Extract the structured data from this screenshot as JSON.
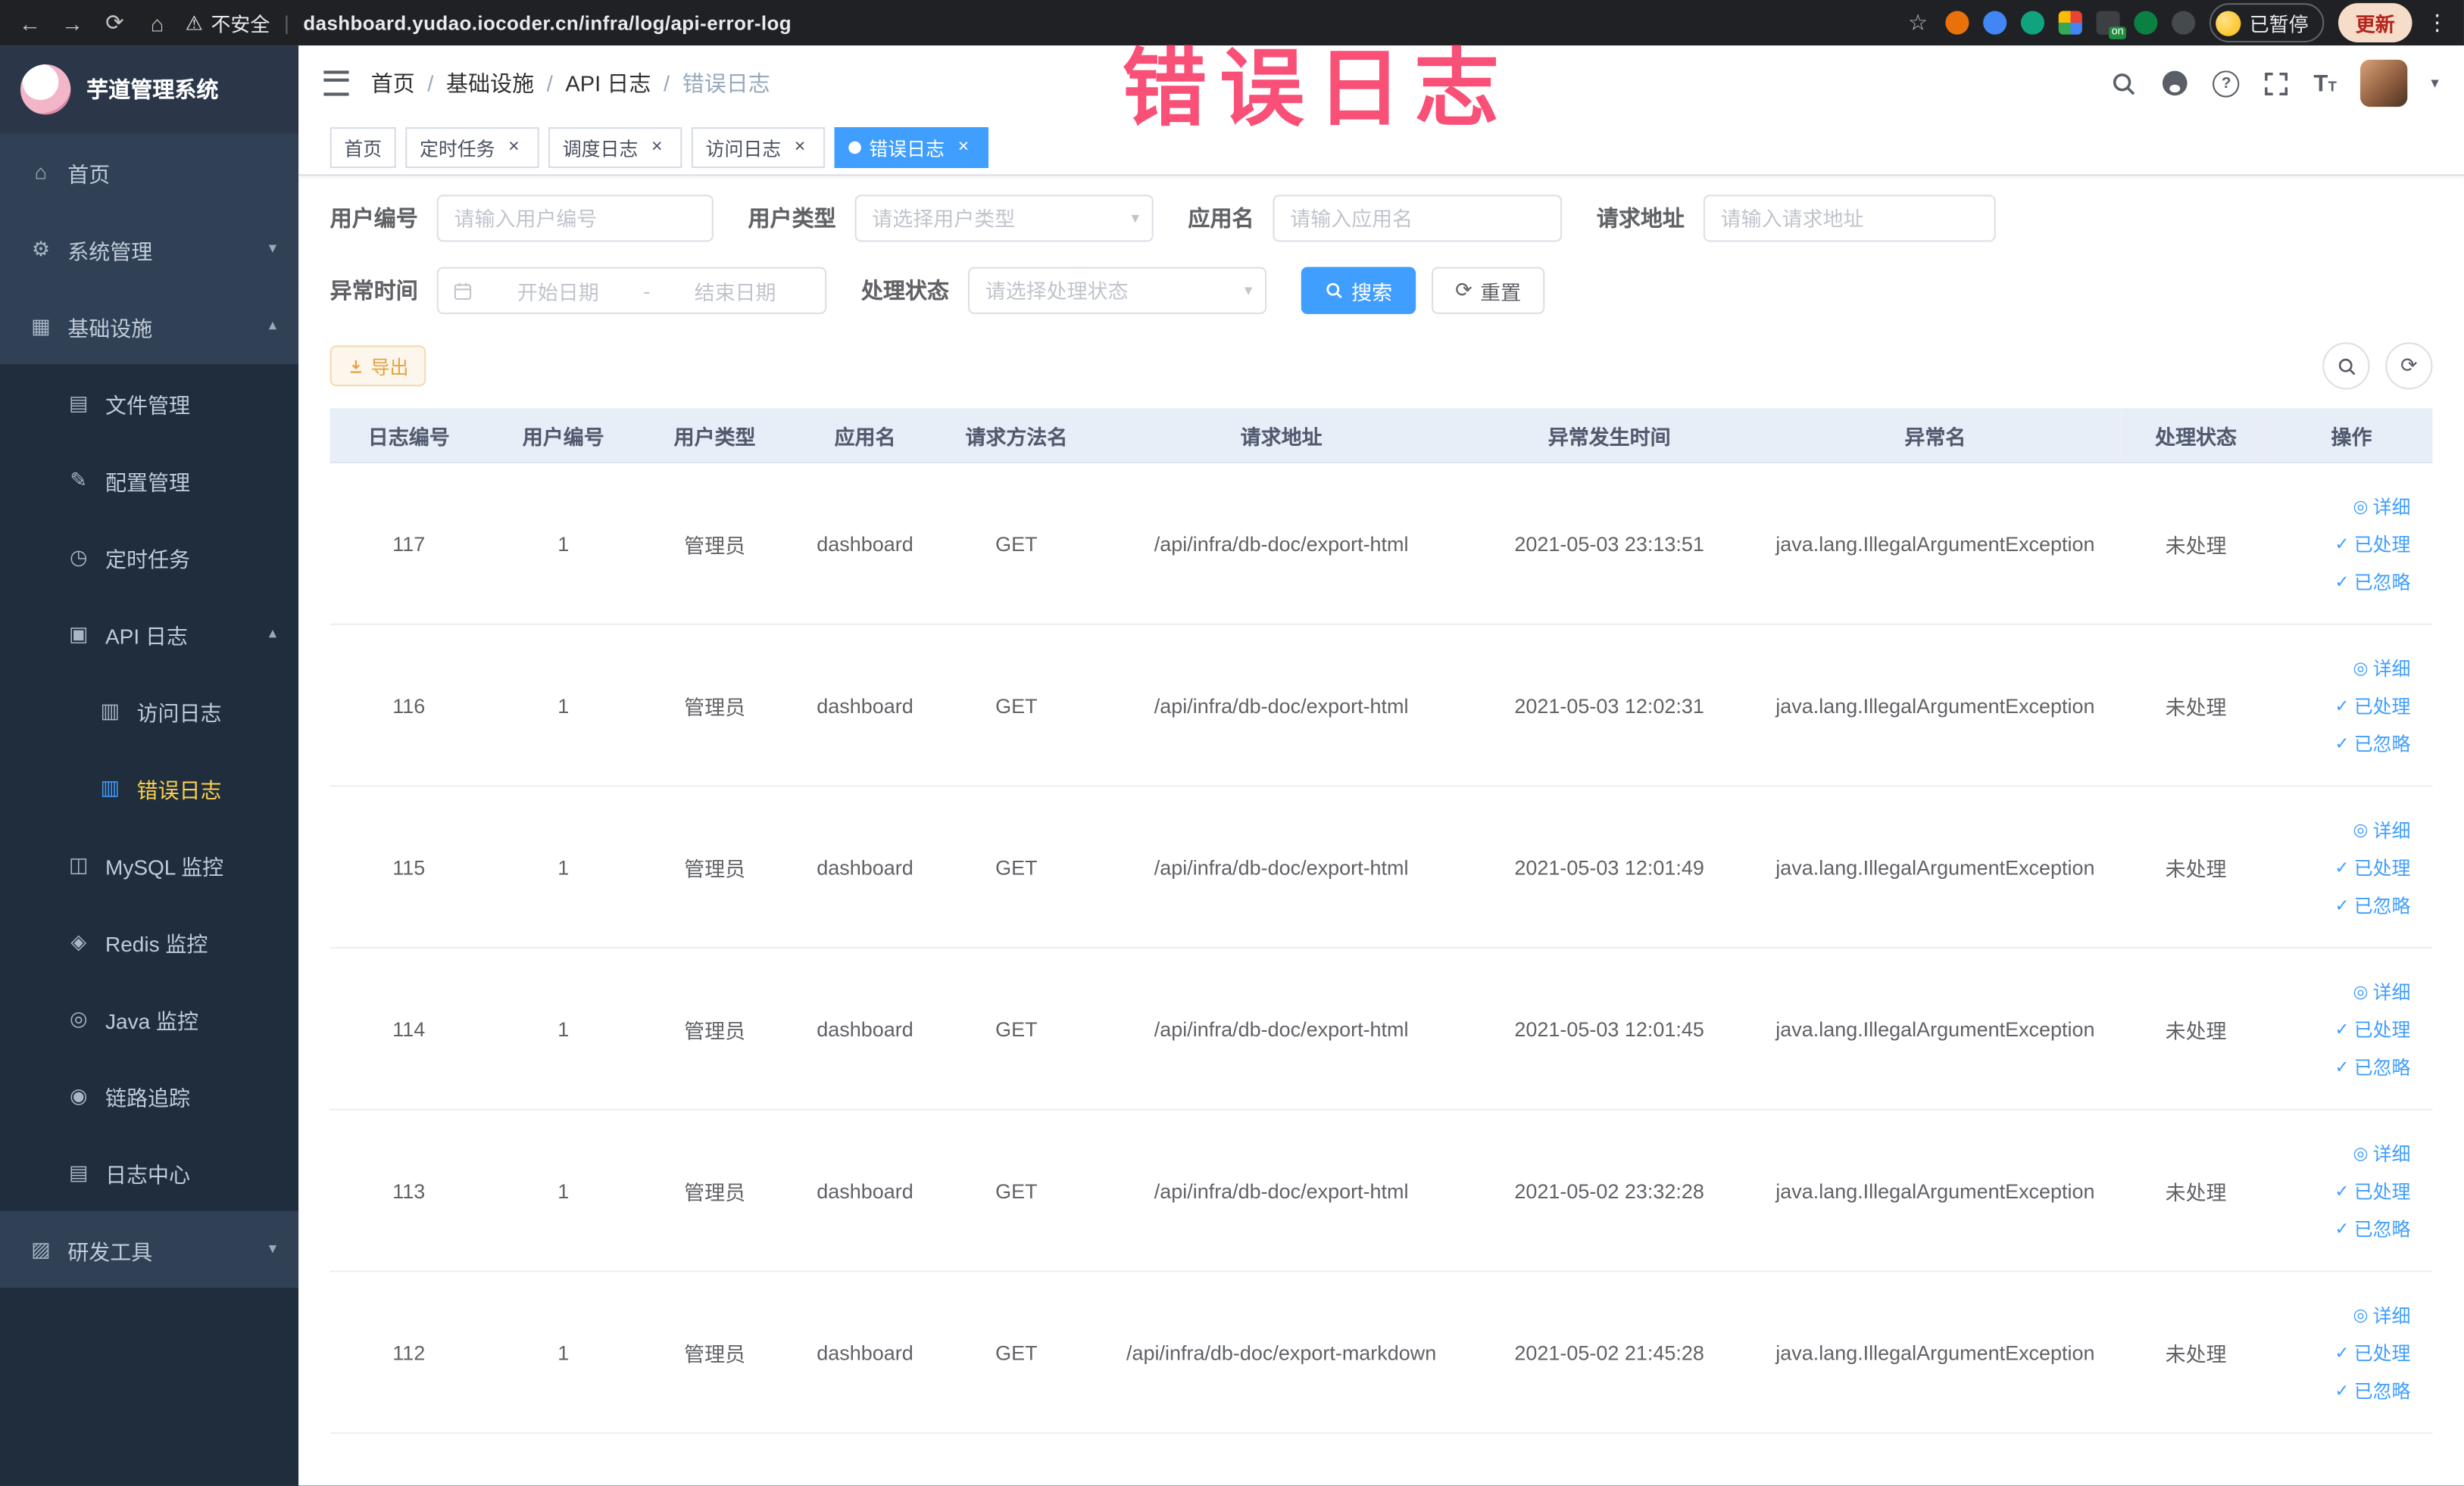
{
  "browser": {
    "security_label": "不安全",
    "url": "dashboard.yudao.iocoder.cn/infra/log/api-error-log",
    "extension_badge": "on",
    "profile_chip_label": "已暂停",
    "update_chip_label": "更新"
  },
  "watermark": "错误日志",
  "sidebar": {
    "title": "芋道管理系统",
    "items": [
      {
        "label": "首页",
        "icon": "⌂"
      },
      {
        "label": "系统管理",
        "icon": "⚙",
        "arrow": "▾"
      },
      {
        "label": "基础设施",
        "icon": "▦",
        "arrow": "▴"
      },
      {
        "label": "文件管理",
        "icon": "▤"
      },
      {
        "label": "配置管理",
        "icon": "✎"
      },
      {
        "label": "定时任务",
        "icon": "◷"
      },
      {
        "label": "API 日志",
        "icon": "▣",
        "arrow": "▴"
      },
      {
        "label": "访问日志",
        "icon": "▥"
      },
      {
        "label": "错误日志",
        "icon": "▥"
      },
      {
        "label": "MySQL 监控",
        "icon": "◫"
      },
      {
        "label": "Redis 监控",
        "icon": "◈"
      },
      {
        "label": "Java 监控",
        "icon": "◎"
      },
      {
        "label": "链路追踪",
        "icon": "◉"
      },
      {
        "label": "日志中心",
        "icon": "▤"
      },
      {
        "label": "研发工具",
        "icon": "▨",
        "arrow": "▾"
      }
    ]
  },
  "breadcrumb": {
    "items": [
      "首页",
      "基础设施",
      "API 日志",
      "错误日志"
    ],
    "separator": "/"
  },
  "tags": [
    {
      "label": "首页"
    },
    {
      "label": "定时任务"
    },
    {
      "label": "调度日志"
    },
    {
      "label": "访问日志"
    },
    {
      "label": "错误日志"
    }
  ],
  "filters": {
    "user_id": {
      "label": "用户编号",
      "placeholder": "请输入用户编号"
    },
    "user_type": {
      "label": "用户类型",
      "placeholder": "请选择用户类型"
    },
    "app_name": {
      "label": "应用名",
      "placeholder": "请输入应用名"
    },
    "request_url": {
      "label": "请求地址",
      "placeholder": "请输入请求地址"
    },
    "exception_time": {
      "label": "异常时间",
      "start_placeholder": "开始日期",
      "range_separator": "-",
      "end_placeholder": "结束日期"
    },
    "process_status": {
      "label": "处理状态",
      "placeholder": "请选择处理状态"
    },
    "search_label": "搜索",
    "reset_label": "重置"
  },
  "toolbar": {
    "export_label": "导出"
  },
  "table": {
    "columns": [
      "日志编号",
      "用户编号",
      "用户类型",
      "应用名",
      "请求方法名",
      "请求地址",
      "异常发生时间",
      "异常名",
      "处理状态",
      "操作"
    ],
    "column_keys": [
      "id",
      "user_id",
      "user_type",
      "app_name",
      "method",
      "url",
      "time",
      "exception",
      "status"
    ],
    "rows": [
      {
        "id": "117",
        "user_id": "1",
        "user_type": "管理员",
        "app_name": "dashboard",
        "method": "GET",
        "url": "/api/infra/db-doc/export-html",
        "time": "2021-05-03 23:13:51",
        "exception": "java.lang.IllegalArgumentException",
        "status": "未处理"
      },
      {
        "id": "116",
        "user_id": "1",
        "user_type": "管理员",
        "app_name": "dashboard",
        "method": "GET",
        "url": "/api/infra/db-doc/export-html",
        "time": "2021-05-03 12:02:31",
        "exception": "java.lang.IllegalArgumentException",
        "status": "未处理"
      },
      {
        "id": "115",
        "user_id": "1",
        "user_type": "管理员",
        "app_name": "dashboard",
        "method": "GET",
        "url": "/api/infra/db-doc/export-html",
        "time": "2021-05-03 12:01:49",
        "exception": "java.lang.IllegalArgumentException",
        "status": "未处理"
      },
      {
        "id": "114",
        "user_id": "1",
        "user_type": "管理员",
        "app_name": "dashboard",
        "method": "GET",
        "url": "/api/infra/db-doc/export-html",
        "time": "2021-05-03 12:01:45",
        "exception": "java.lang.IllegalArgumentException",
        "status": "未处理"
      },
      {
        "id": "113",
        "user_id": "1",
        "user_type": "管理员",
        "app_name": "dashboard",
        "method": "GET",
        "url": "/api/infra/db-doc/export-html",
        "time": "2021-05-02 23:32:28",
        "exception": "java.lang.IllegalArgumentException",
        "status": "未处理"
      },
      {
        "id": "112",
        "user_id": "1",
        "user_type": "管理员",
        "app_name": "dashboard",
        "method": "GET",
        "url": "/api/infra/db-doc/export-markdown",
        "time": "2021-05-02 21:45:28",
        "exception": "java.lang.IllegalArgumentException",
        "status": "未处理"
      }
    ],
    "row_actions": [
      {
        "key": "detail",
        "label": "详细",
        "icon": "◎"
      },
      {
        "key": "processed",
        "label": "已处理",
        "icon": "✓"
      },
      {
        "key": "ignore",
        "label": "已忽略",
        "icon": "✓"
      }
    ]
  },
  "icons": {
    "back": "←",
    "forward": "→",
    "reload": "⟳",
    "home": "⌂",
    "warning": "⚠",
    "divider": "|",
    "star": "☆",
    "menu_dots": "⋮",
    "caret_down": "▾",
    "close": "×",
    "refresh": "⟳",
    "question": "?",
    "text_big": "T",
    "text_small": "T"
  },
  "colors": {
    "accent": "#409eff",
    "watermark_pink": "#f83864",
    "warning_text": "#e6a23c",
    "sidebar_bg": "#304156",
    "submenu_bg": "#1f2d3d",
    "active_menu_text": "#ffd04b",
    "tag_active_bg": "#409eff",
    "table_header_bg": "#e8eef7"
  }
}
